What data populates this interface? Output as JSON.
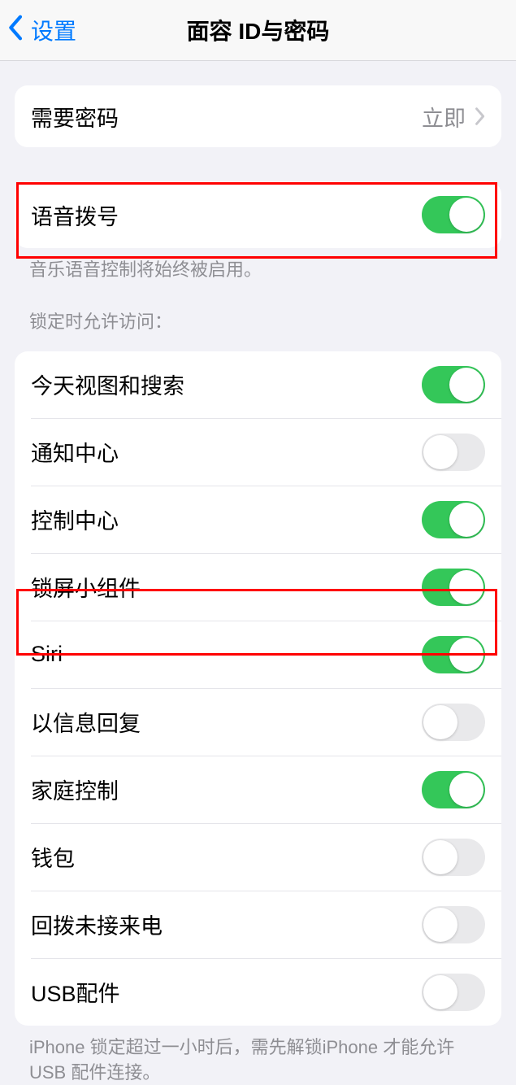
{
  "nav": {
    "back": "设置",
    "title": "面容 ID与密码"
  },
  "passcode_row": {
    "label": "需要密码",
    "value": "立即"
  },
  "voice_dial": {
    "label": "语音拨号",
    "on": true
  },
  "voice_dial_footer": "音乐语音控制将始终被启用。",
  "locked_header": "锁定时允许访问：",
  "locked_items": [
    {
      "label": "今天视图和搜索",
      "on": true
    },
    {
      "label": "通知中心",
      "on": false
    },
    {
      "label": "控制中心",
      "on": true
    },
    {
      "label": "锁屏小组件",
      "on": true
    },
    {
      "label": "Siri",
      "on": true
    },
    {
      "label": "以信息回复",
      "on": false
    },
    {
      "label": "家庭控制",
      "on": true
    },
    {
      "label": "钱包",
      "on": false
    },
    {
      "label": "回拨未接来电",
      "on": false
    },
    {
      "label": "USB配件",
      "on": false
    }
  ],
  "usb_footer": "iPhone 锁定超过一小时后，需先解锁iPhone 才能允许USB 配件连接。"
}
